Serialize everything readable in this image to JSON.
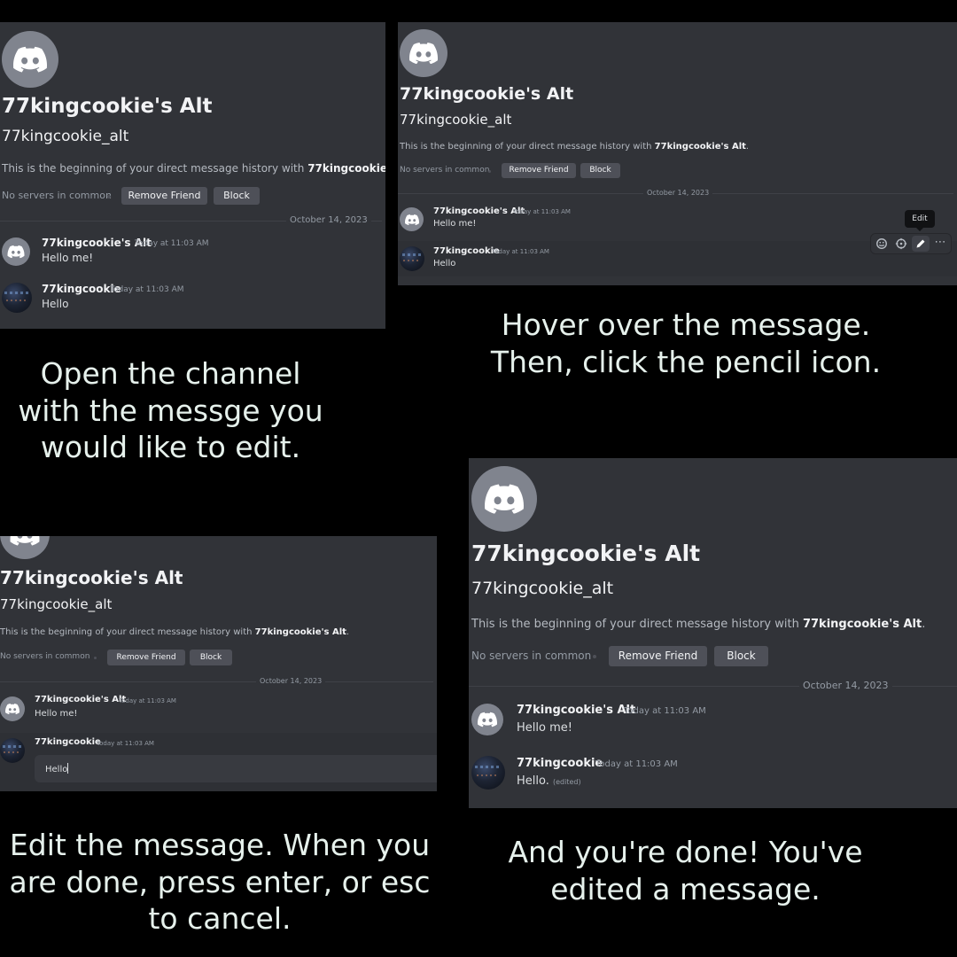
{
  "colors": {
    "page_background": "#000000",
    "chat_background": "#313338",
    "button_background": "#4e5058",
    "default_avatar": "#80848e",
    "caption_text": "#e6f1ec"
  },
  "profile": {
    "display_name": "77kingcookie's Alt",
    "username": "77kingcookie_alt",
    "intro_prefix": "This is the beginning of your direct message history with",
    "intro_name": "77kingcookie's Alt",
    "intro_suffix": ".",
    "mutual_servers": "No servers in common",
    "remove_friend_label": "Remove Friend",
    "block_label": "Block",
    "avatar_icon": "discord-logo-icon"
  },
  "date_divider": "October 14, 2023",
  "messages": {
    "first": {
      "author": "77kingcookie's Alt",
      "timestamp": "Today at 11:03 AM",
      "text": "Hello me!",
      "avatar_icon": "discord-logo-icon"
    },
    "second": {
      "author": "77kingcookie",
      "timestamp": "Today at 11:03 AM",
      "text": "Hello",
      "edited_text": "Hello.",
      "edited_marker": "(edited)"
    }
  },
  "hover_toolbar": {
    "tooltip": "Edit",
    "icons": [
      "add-reaction-icon",
      "super-reaction-icon",
      "pencil-icon",
      "more-icon"
    ],
    "more_glyph": "⋯"
  },
  "captions": {
    "step1": "Open the channel with the messge you would like to edit.",
    "step2": "Hover over the message. Then, click the pencil icon.",
    "step3": "Edit the message. When you are done, press enter, or esc to cancel.",
    "step4": "And you're done! You've edited a message."
  }
}
